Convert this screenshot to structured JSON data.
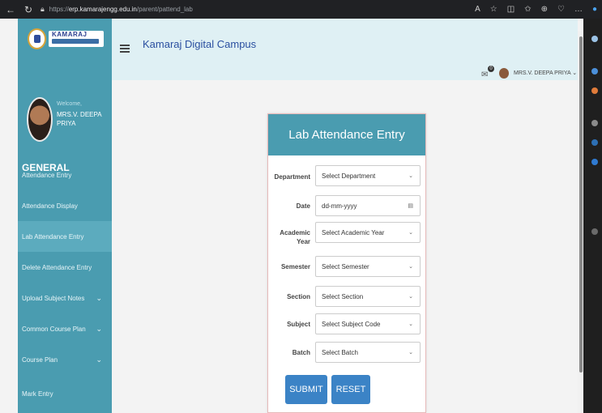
{
  "browser": {
    "url_prefix": "https://",
    "url_domain": "erp.kamarajengg.edu.in",
    "url_path": "/parent/pattend_lab"
  },
  "brand": {
    "name": "KAMARAJ"
  },
  "sidebar": {
    "welcome": "Welcome,",
    "user_name": "MRS.V. DEEPA PRIYA",
    "section_title": "GENERAL",
    "items": [
      {
        "label": "Attendance Entry"
      },
      {
        "label": "Attendance Display"
      },
      {
        "label": "Lab Attendance Entry"
      },
      {
        "label": "Delete Attendance Entry"
      },
      {
        "label": "Upload Subject Notes"
      },
      {
        "label": "Common Course Plan"
      },
      {
        "label": "Course Plan"
      },
      {
        "label": "Mark Entry"
      }
    ]
  },
  "header": {
    "title": "Kamaraj Digital Campus",
    "mail_count": "0",
    "user_label": "MRS.V. DEEPA PRIYA"
  },
  "form": {
    "title": "Lab Attendance Entry",
    "fields": [
      {
        "label": "Department",
        "placeholder": "Select Department"
      },
      {
        "label": "Date",
        "placeholder": "dd-mm-yyyy"
      },
      {
        "label": "Academic Year",
        "placeholder": "Select Academic Year"
      },
      {
        "label": "Semester",
        "placeholder": "Select Semester"
      },
      {
        "label": "Section",
        "placeholder": "Select Section"
      },
      {
        "label": "Subject",
        "placeholder": "Select Subject Code"
      },
      {
        "label": "Batch",
        "placeholder": "Select Batch"
      }
    ],
    "submit_label": "SUBMIT",
    "reset_label": "RESET"
  },
  "colors": {
    "sidebar": "#4a9cb0",
    "header_bg": "#dff0f4",
    "card_header": "#4a9cb0",
    "button": "#3b83c6"
  }
}
